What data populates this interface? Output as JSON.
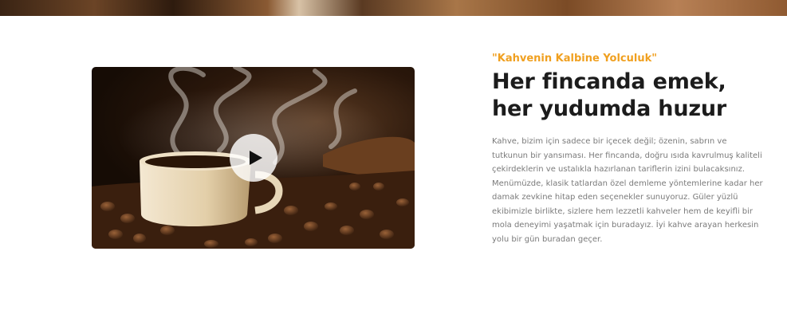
{
  "hero": {
    "play_label": "play-icon"
  },
  "about": {
    "eyebrow": "\"Kahvenin Kalbine Yolculuk\"",
    "headline": "Her fincanda emek, her yudumda huzur",
    "body": "Kahve, bizim için sadece bir içecek değil; özenin, sabrın ve tutkunun bir yansıması. Her fincanda, doğru ısıda kavrulmuş kaliteli çekirdeklerin ve ustalıkla hazırlanan tariflerin izini bulacaksınız. Menümüzde, klasik tatlardan özel demleme yöntemlerine kadar her damak zevkine hitap eden seçenekler sunuyoruz. Güler yüzlü ekibimizle birlikte, sizlere hem lezzetli kahveler hem de keyifli bir mola deneyimi yaşatmak için buradayız. İyi kahve arayan herkesin yolu bir gün buradan geçer."
  },
  "colors": {
    "accent": "#f0a020",
    "headline": "#1c1c1c",
    "body": "#7a7a7a"
  }
}
